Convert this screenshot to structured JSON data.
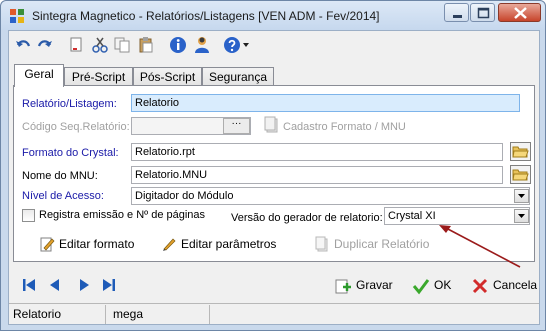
{
  "window": {
    "title": "Sintegra Magnetico -  Relatórios/Listagens [VEN ADM - Fev/2014]"
  },
  "toolbar": {
    "icons": [
      "undo-icon",
      "redo-icon",
      "new-document-icon",
      "cut-icon",
      "copy-icon",
      "paste-icon",
      "info-icon",
      "user-icon",
      "help-icon",
      "dropdown-arrow-icon"
    ]
  },
  "tabs": [
    {
      "label": "Geral",
      "active": true
    },
    {
      "label": "Pré-Script",
      "active": false
    },
    {
      "label": "Pós-Script",
      "active": false
    },
    {
      "label": "Segurança",
      "active": false
    }
  ],
  "form": {
    "relatorio_label": "Relatório/Listagem:",
    "relatorio_value": "Relatorio",
    "codigo_label": "Código Seq.Relatório:",
    "codigo_button": "···",
    "cadastro_formato_label": "Cadastro Formato / MNU",
    "formato_label": "Formato do Crystal:",
    "formato_value": "Relatorio.rpt",
    "mnu_label": "Nome do MNU:",
    "mnu_value": "Relatorio.MNU",
    "nivel_label": "Nível de Acesso:",
    "nivel_value": "Digitador do Módulo",
    "registra_label": "Registra emissão e Nº de páginas",
    "versao_label": "Versão do gerador de relatorio:",
    "versao_value": "Crystal XI"
  },
  "actions": {
    "editar_formato": "Editar formato",
    "editar_parametros": "Editar parâmetros",
    "duplicar_relatorio": "Duplicar Relatório"
  },
  "buttons": {
    "gravar": "Gravar",
    "ok": "OK",
    "cancela": "Cancela"
  },
  "status": {
    "cell1": "Relatorio",
    "cell2": "mega"
  },
  "colors": {
    "accent_blue": "#1a1aa8",
    "annotation_arrow": "#9b1b1b",
    "nav_blue": "#1e5bb8"
  }
}
